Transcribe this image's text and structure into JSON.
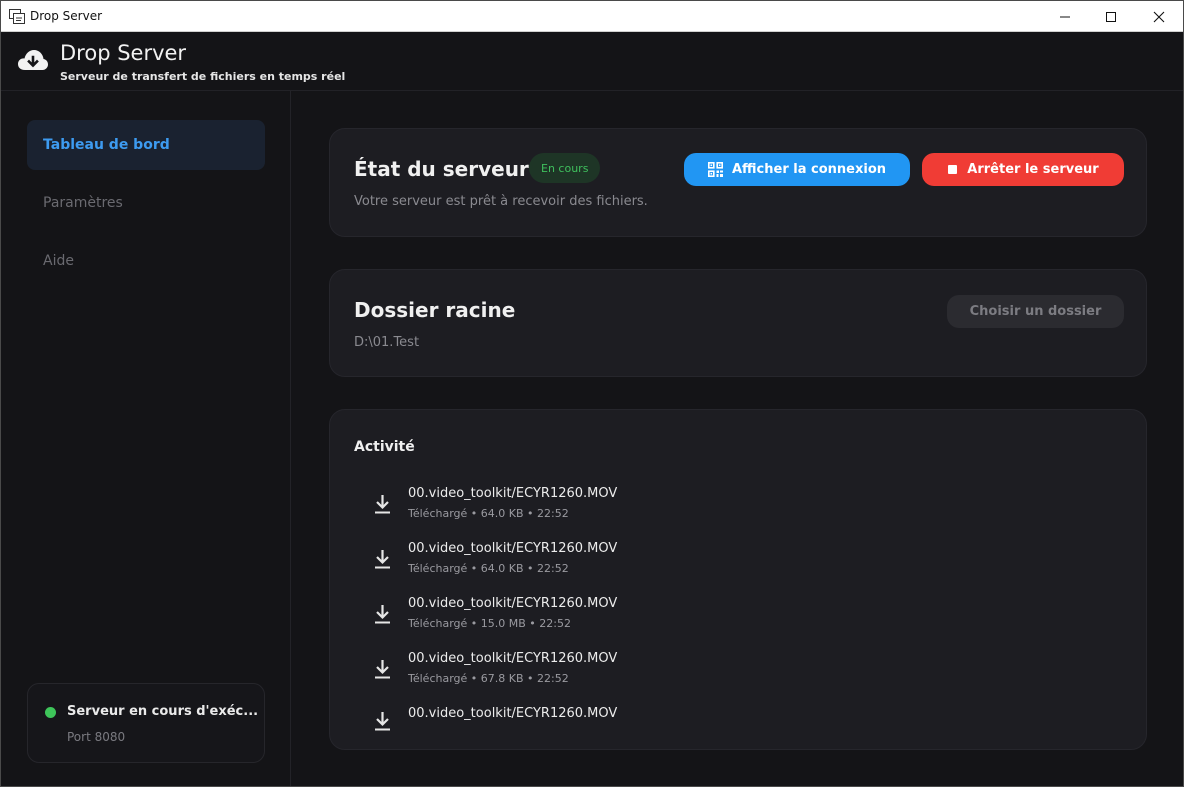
{
  "window": {
    "title": "Drop Server"
  },
  "header": {
    "title": "Drop Server",
    "subtitle": "Serveur de transfert de fichiers en temps réel",
    "icon": "cloud-download-icon"
  },
  "sidebar": {
    "items": [
      {
        "label": "Tableau de bord",
        "active": true
      },
      {
        "label": "Paramètres",
        "active": false
      },
      {
        "label": "Aide",
        "active": false
      }
    ],
    "status": {
      "text": "Serveur en cours d'exéc...",
      "port": "Port 8080",
      "color": "#3ec55a"
    }
  },
  "server_card": {
    "title": "État du serveur",
    "badge": "En cours",
    "description": "Votre serveur est prêt à recevoir des fichiers.",
    "show_connection_label": "Afficher la connexion",
    "stop_label": "Arrêter le serveur"
  },
  "folder_card": {
    "title": "Dossier racine",
    "path": "D:\\01.Test",
    "choose_label": "Choisir un dossier"
  },
  "activity": {
    "title": "Activité",
    "items": [
      {
        "name": "00.video_toolkit/ECYR1260.MOV",
        "meta": "Téléchargé • 64.0 KB • 22:52"
      },
      {
        "name": "00.video_toolkit/ECYR1260.MOV",
        "meta": "Téléchargé • 64.0 KB • 22:52"
      },
      {
        "name": "00.video_toolkit/ECYR1260.MOV",
        "meta": "Téléchargé • 15.0 MB • 22:52"
      },
      {
        "name": "00.video_toolkit/ECYR1260.MOV",
        "meta": "Téléchargé • 67.8 KB • 22:52"
      },
      {
        "name": "00.video_toolkit/ECYR1260.MOV",
        "meta": ""
      }
    ]
  },
  "colors": {
    "accent": "#2196f3",
    "danger": "#f03c35",
    "success": "#3fbf5d",
    "nav_active": "#3d9bf0"
  }
}
